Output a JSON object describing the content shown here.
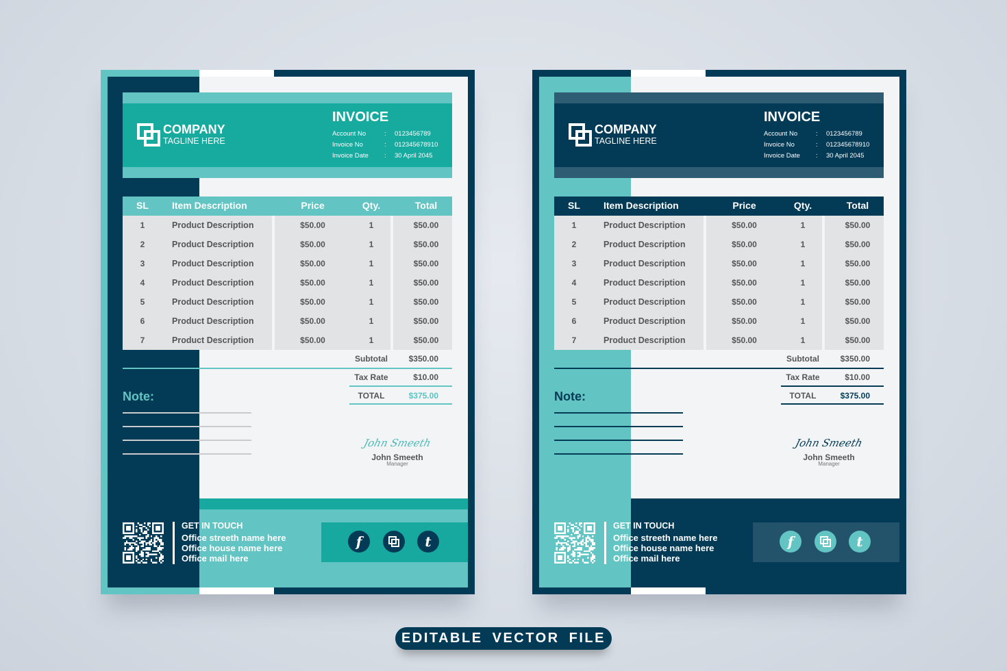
{
  "invoice": {
    "company": "COMPANY",
    "tagline": "TAGLINE HERE",
    "title": "INVOICE",
    "details": [
      {
        "label": "Account No",
        "sep": ":",
        "value": "0123456789"
      },
      {
        "label": "Invoice No",
        "sep": ":",
        "value": "012345678910"
      },
      {
        "label": "Invoice Date",
        "sep": ":",
        "value": "30 April 2045"
      }
    ],
    "columns": [
      "SL",
      "Item Description",
      "Price",
      "Qty.",
      "Total"
    ],
    "rows": [
      {
        "sl": "1",
        "desc": "Product Description",
        "price": "$50.00",
        "qty": "1",
        "total": "$50.00"
      },
      {
        "sl": "2",
        "desc": "Product Description",
        "price": "$50.00",
        "qty": "1",
        "total": "$50.00"
      },
      {
        "sl": "3",
        "desc": "Product Description",
        "price": "$50.00",
        "qty": "1",
        "total": "$50.00"
      },
      {
        "sl": "4",
        "desc": "Product Description",
        "price": "$50.00",
        "qty": "1",
        "total": "$50.00"
      },
      {
        "sl": "5",
        "desc": "Product Description",
        "price": "$50.00",
        "qty": "1",
        "total": "$50.00"
      },
      {
        "sl": "6",
        "desc": "Product Description",
        "price": "$50.00",
        "qty": "1",
        "total": "$50.00"
      },
      {
        "sl": "7",
        "desc": "Product Description",
        "price": "$50.00",
        "qty": "1",
        "total": "$50.00"
      }
    ],
    "totals": [
      {
        "label": "Subtotal",
        "value": "$350.00"
      },
      {
        "label": "Tax Rate",
        "value": "$10.00"
      },
      {
        "label": "TOTAL",
        "value": "$375.00"
      }
    ],
    "note_label": "Note:",
    "signature_script": "John Smeeth",
    "signer_name": "John Smeeth",
    "signer_role": "Manager",
    "contact_heading": "GET IN TOUCH",
    "contact_lines": [
      "Office streeth name here",
      "Office house name here",
      "Office mail here"
    ],
    "social_icons": [
      "facebook-icon",
      "instagram-icon",
      "tumblr-icon"
    ]
  },
  "variants": [
    {
      "name": "teal",
      "colors": {
        "outer": "#033b57",
        "strip": "#62c4c3",
        "col": "#033b57",
        "hmain": "#17aa9f",
        "hstripe": "#62c4c3",
        "thead": "#62c4c3",
        "line": "#62c4c3",
        "note": "#62c4c3",
        "nline": "#c9cbcc",
        "total": "#5cc3c1",
        "sig": "#4fb9b8",
        "fmain": "#62c4c3",
        "fstripe": "#17a99f",
        "sbox": "#17a99f",
        "icbg": "#033b57"
      }
    },
    {
      "name": "navy",
      "colors": {
        "outer": "#033b57",
        "strip": "#033b57",
        "col": "#62c4c3",
        "hmain": "#033b57",
        "hstripe": "#2e5c72",
        "thead": "#033b57",
        "line": "#033b57",
        "note": "#033b57",
        "nline": "#033b57",
        "total": "#033b57",
        "sig": "#033b57",
        "fmain": "#033b57",
        "fstripe": "#033b57",
        "sbox": "#22536b",
        "icbg": "#62c4c3"
      }
    }
  ],
  "banner": {
    "label": "EDITABLE VECTOR FILE"
  }
}
